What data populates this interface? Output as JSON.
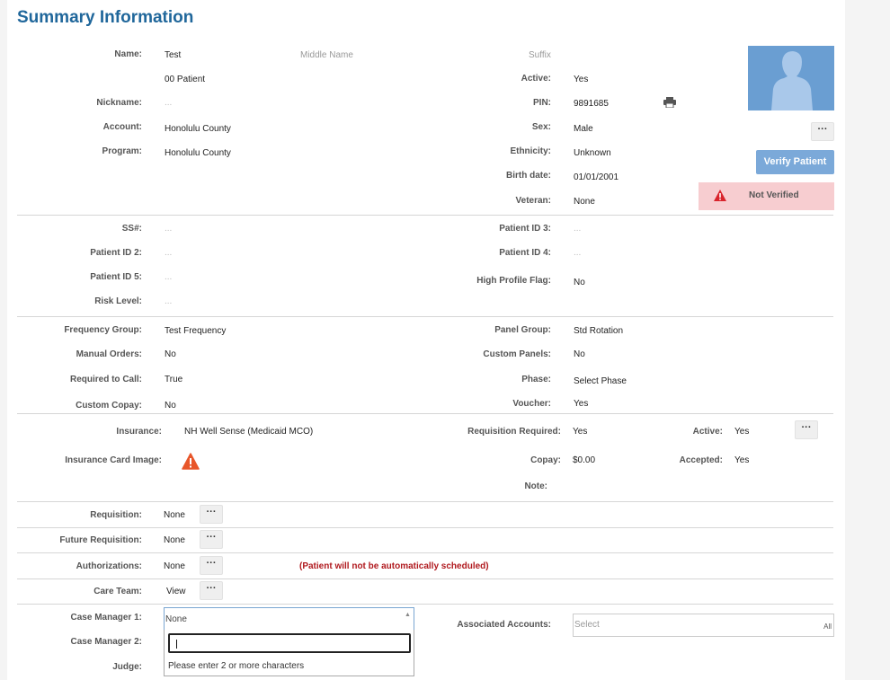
{
  "title": "Summary Information",
  "top": {
    "name_label": "Name:",
    "first_name": "Test",
    "middle_placeholder": "Middle Name",
    "suffix_placeholder": "Suffix",
    "last_name": "00 Patient",
    "active_label": "Active:",
    "active_value": "Yes",
    "nickname_label": "Nickname:",
    "nickname_value": "...",
    "pin_label": "PIN:",
    "pin_value": "9891685",
    "account_label": "Account:",
    "account_value": "Honolulu County",
    "sex_label": "Sex:",
    "sex_value": "Male",
    "program_label": "Program:",
    "program_value": "Honolulu County",
    "ethnicity_label": "Ethnicity:",
    "ethnicity_value": "Unknown",
    "birth_label": "Birth date:",
    "birth_value": "01/01/2001",
    "veteran_label": "Veteran:",
    "veteran_value": "None",
    "verify_button": "Verify Patient",
    "not_verified": "Not Verified",
    "more": "···"
  },
  "ids": {
    "ss_label": "SS#:",
    "ss_value": "...",
    "pid2_label": "Patient ID 2:",
    "pid2_value": "...",
    "pid3_label": "Patient ID 3:",
    "pid3_value": "...",
    "pid4_label": "Patient ID 4:",
    "pid4_value": "...",
    "pid5_label": "Patient ID 5:",
    "pid5_value": "...",
    "hpf_label": "High Profile Flag:",
    "hpf_value": "No",
    "risk_label": "Risk Level:",
    "risk_value": "..."
  },
  "freq": {
    "fg_label": "Frequency Group:",
    "fg_value": "Test Frequency",
    "pg_label": "Panel Group:",
    "pg_value": "Std Rotation",
    "mo_label": "Manual Orders:",
    "mo_value": "No",
    "cp_label": "Custom Panels:",
    "cp_value": "No",
    "rc_label": "Required to Call:",
    "rc_value": "True",
    "ph_label": "Phase:",
    "ph_value": "Select Phase",
    "cc_label": "Custom Copay:",
    "cc_value": "No",
    "vo_label": "Voucher:",
    "vo_value": "Yes"
  },
  "insurance": {
    "ins_label": "Insurance:",
    "ins_value": "NH Well Sense (Medicaid MCO)",
    "req_label": "Requisition Required:",
    "req_value": "Yes",
    "act_label": "Active:",
    "act_value": "Yes",
    "card_label": "Insurance Card Image:",
    "copay_label": "Copay:",
    "copay_value": "$0.00",
    "acc_label": "Accepted:",
    "acc_value": "Yes",
    "note_label": "Note:"
  },
  "rows": {
    "requisition_label": "Requisition:",
    "requisition_value": "None",
    "future_label": "Future Requisition:",
    "future_value": "None",
    "auth_label": "Authorizations:",
    "auth_value": "None",
    "auth_warning": "(Patient will not be automatically scheduled)",
    "care_label": "Care Team:",
    "care_value": "View"
  },
  "case": {
    "cm1_label": "Case Manager 1:",
    "cm1_value": "None",
    "cm2_label": "Case Manager 2:",
    "judge_label": "Judge:",
    "dropdown_hint": "Please enter 2 or more characters",
    "assoc_label": "Associated Accounts:",
    "assoc_placeholder": "Select",
    "assoc_all": "All"
  }
}
